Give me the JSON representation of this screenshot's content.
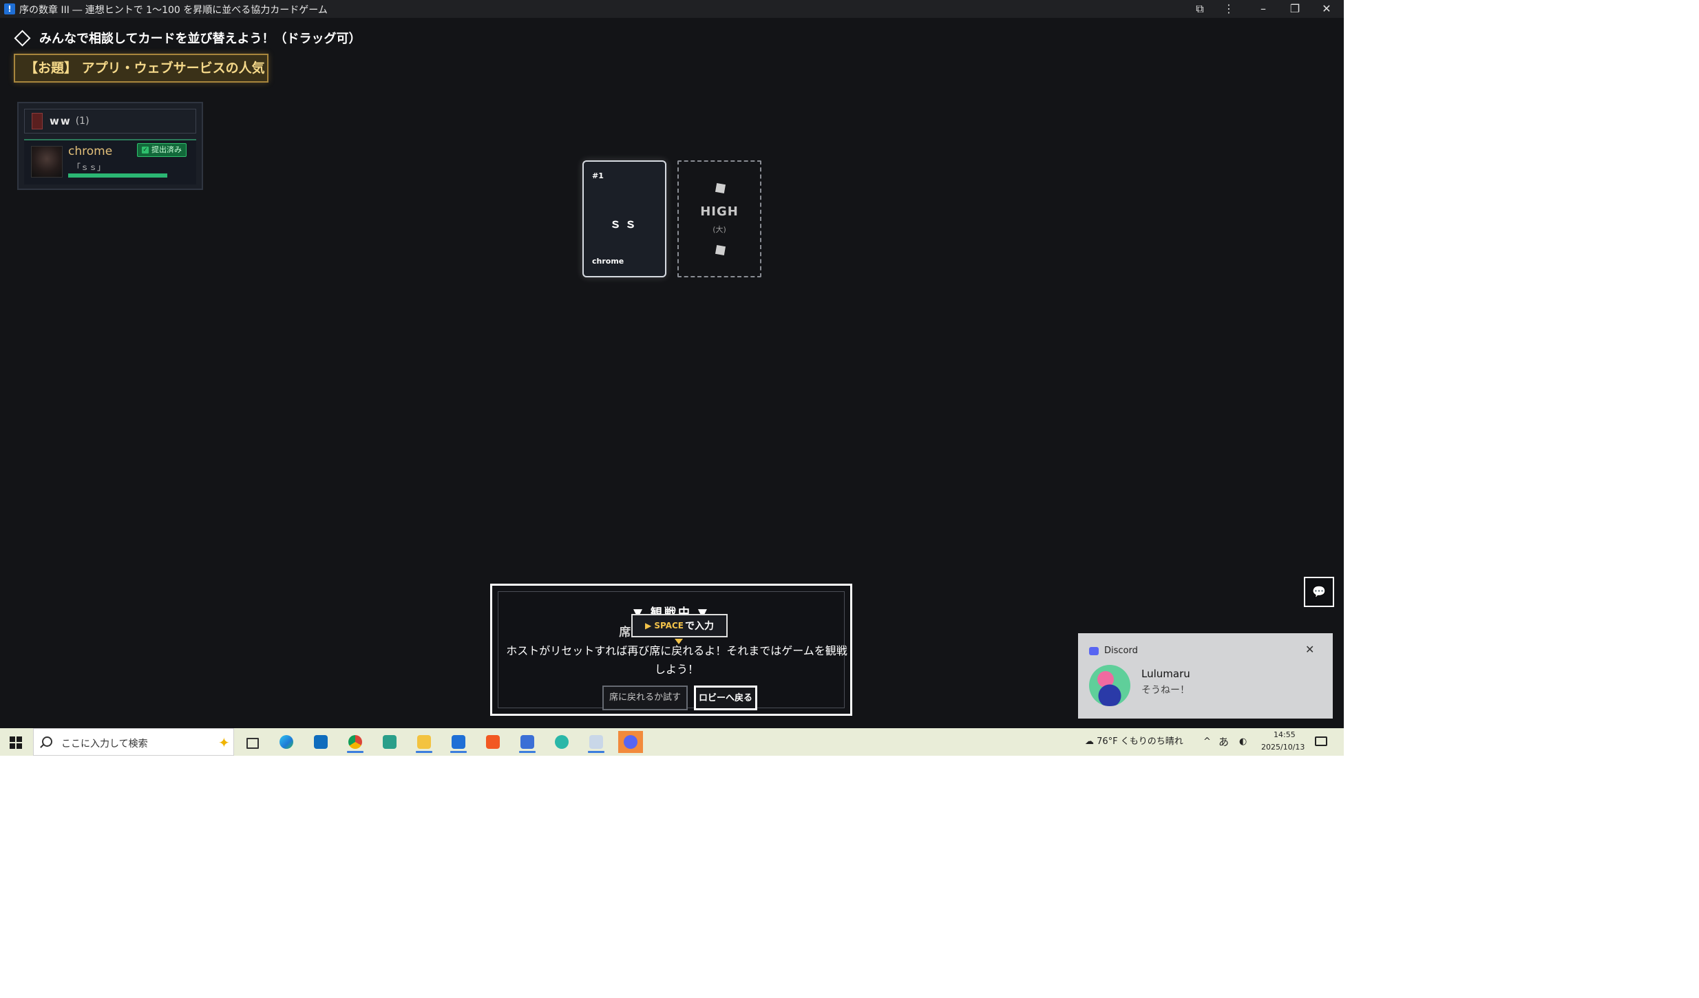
{
  "window": {
    "title": "序の数章 III ― 連想ヒントで 1〜100 を昇順に並べる協力カードゲーム",
    "icon": "app-icon",
    "controls": {
      "extension": "⧉",
      "menu": "⋮",
      "minimize": "–",
      "restore": "❐",
      "close": "✕"
    }
  },
  "game": {
    "instruction": "みんなで相談してカードを並び替えよう！（ドラッグ可）",
    "topic": "【お題】 アプリ・ウェブサービスの人気",
    "team": {
      "name": "ww",
      "count": "(1)"
    },
    "players": [
      {
        "name": "chrome",
        "word": "「ｓｓ」",
        "status": "提出済み",
        "progress": 1.0
      }
    ],
    "cards": [
      {
        "number": "#1",
        "word": "ｓｓ",
        "owner": "chrome"
      }
    ],
    "high_slot": {
      "label": "HIGH",
      "sub": "(大)"
    }
  },
  "spectate": {
    "title": "▼ 観戦中 ▼",
    "seat_text": "席は埋まっています",
    "space_key": "▶ SPACE",
    "space_text": "で入力",
    "message": "ホストがリセットすれば再び席に戻れるよ！それまではゲームを観戦しよう！",
    "retry_button": "席に戻れるか試す",
    "lobby_button": "ロビーへ戻る"
  },
  "chat_button_icon": "chat-bubble-icon",
  "notification": {
    "app": "Discord",
    "sender": "Lulumaru",
    "message": "そうねー！",
    "close": "✕"
  },
  "taskbar": {
    "search_placeholder": "ここに入力して検索",
    "apps": [
      "task-view",
      "edge",
      "outlook",
      "chrome",
      "vs-code",
      "file-explorer",
      "vs-code",
      "brave",
      "app",
      "app",
      "paint",
      "discord"
    ],
    "weather": "76°F  くもりのち晴れ",
    "ime": "あ",
    "time": "14:55",
    "date": "2025/10/13"
  },
  "colors": {
    "background": "#131417",
    "topic_gold": "#f5d98a",
    "status_green": "#2bb673",
    "taskbar": "#e9edd8"
  }
}
